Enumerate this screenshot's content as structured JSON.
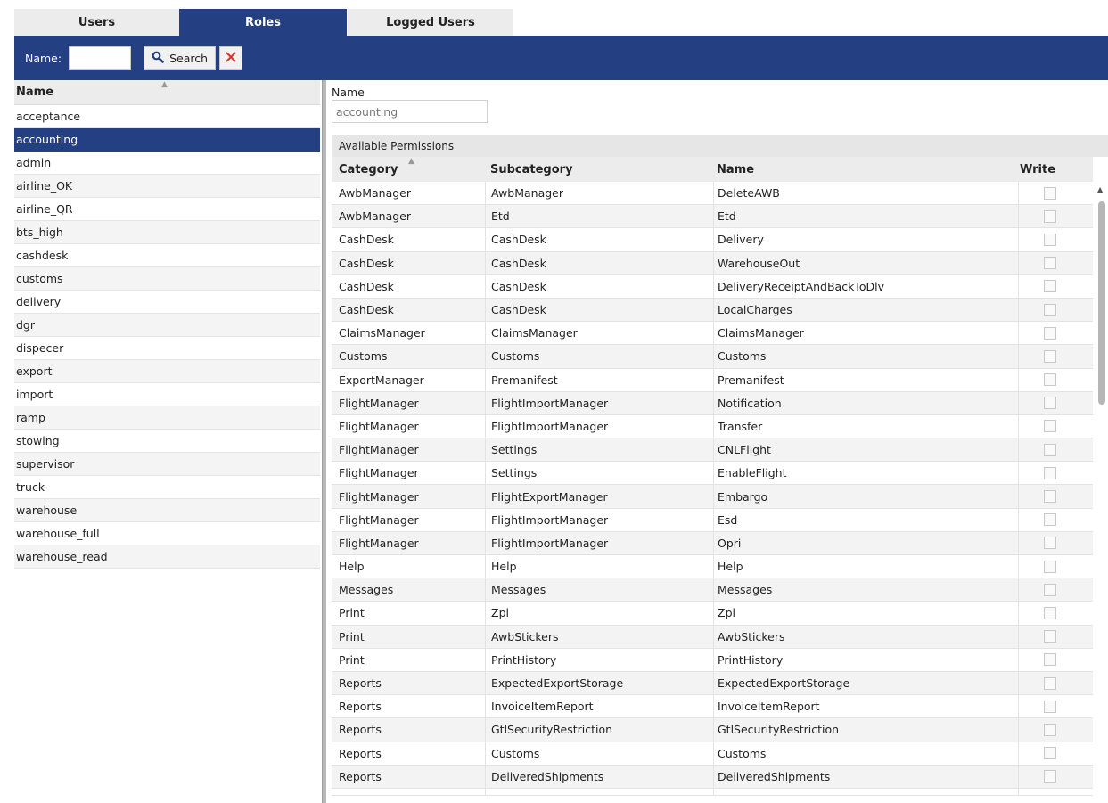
{
  "tabs": [
    {
      "label": "Users",
      "active": false
    },
    {
      "label": "Roles",
      "active": true
    },
    {
      "label": "Logged Users",
      "active": false
    }
  ],
  "toolbar": {
    "name_label": "Name:",
    "name_value": "",
    "search_label": "Search",
    "search_icon": "magnifier-icon",
    "clear_icon": "close-icon"
  },
  "roles_list": {
    "header": "Name",
    "sort": "ascending",
    "selected": "accounting",
    "items": [
      "acceptance",
      "accounting",
      "admin",
      "airline_OK",
      "airline_QR",
      "bts_high",
      "cashdesk",
      "customs",
      "delivery",
      "dgr",
      "dispecer",
      "export",
      "import",
      "ramp",
      "stowing",
      "supervisor",
      "truck",
      "warehouse",
      "warehouse_full",
      "warehouse_read"
    ]
  },
  "detail": {
    "name_label": "Name",
    "name_value": "accounting",
    "permissions_title": "Available Permissions",
    "columns": [
      "Category",
      "Subcategory",
      "Name",
      "Write"
    ],
    "sort_column": "Category",
    "rows": [
      {
        "category": "AwbManager",
        "subcategory": "AwbManager",
        "name": "DeleteAWB",
        "write": false
      },
      {
        "category": "AwbManager",
        "subcategory": "Etd",
        "name": "Etd",
        "write": false
      },
      {
        "category": "CashDesk",
        "subcategory": "CashDesk",
        "name": "Delivery",
        "write": false
      },
      {
        "category": "CashDesk",
        "subcategory": "CashDesk",
        "name": "WarehouseOut",
        "write": false
      },
      {
        "category": "CashDesk",
        "subcategory": "CashDesk",
        "name": "DeliveryReceiptAndBackToDlv",
        "write": false
      },
      {
        "category": "CashDesk",
        "subcategory": "CashDesk",
        "name": "LocalCharges",
        "write": false
      },
      {
        "category": "ClaimsManager",
        "subcategory": "ClaimsManager",
        "name": "ClaimsManager",
        "write": false
      },
      {
        "category": "Customs",
        "subcategory": "Customs",
        "name": "Customs",
        "write": false
      },
      {
        "category": "ExportManager",
        "subcategory": "Premanifest",
        "name": "Premanifest",
        "write": false
      },
      {
        "category": "FlightManager",
        "subcategory": "FlightImportManager",
        "name": "Notification",
        "write": false
      },
      {
        "category": "FlightManager",
        "subcategory": "FlightImportManager",
        "name": "Transfer",
        "write": false
      },
      {
        "category": "FlightManager",
        "subcategory": "Settings",
        "name": "CNLFlight",
        "write": false
      },
      {
        "category": "FlightManager",
        "subcategory": "Settings",
        "name": "EnableFlight",
        "write": false
      },
      {
        "category": "FlightManager",
        "subcategory": "FlightExportManager",
        "name": "Embargo",
        "write": false
      },
      {
        "category": "FlightManager",
        "subcategory": "FlightImportManager",
        "name": "Esd",
        "write": false
      },
      {
        "category": "FlightManager",
        "subcategory": "FlightImportManager",
        "name": "Opri",
        "write": false
      },
      {
        "category": "Help",
        "subcategory": "Help",
        "name": "Help",
        "write": false
      },
      {
        "category": "Messages",
        "subcategory": "Messages",
        "name": "Messages",
        "write": false
      },
      {
        "category": "Print",
        "subcategory": "Zpl",
        "name": "Zpl",
        "write": false
      },
      {
        "category": "Print",
        "subcategory": "AwbStickers",
        "name": "AwbStickers",
        "write": false
      },
      {
        "category": "Print",
        "subcategory": "PrintHistory",
        "name": "PrintHistory",
        "write": false
      },
      {
        "category": "Reports",
        "subcategory": "ExpectedExportStorage",
        "name": "ExpectedExportStorage",
        "write": false
      },
      {
        "category": "Reports",
        "subcategory": "InvoiceItemReport",
        "name": "InvoiceItemReport",
        "write": false
      },
      {
        "category": "Reports",
        "subcategory": "GtlSecurityRestriction",
        "name": "GtlSecurityRestriction",
        "write": false
      },
      {
        "category": "Reports",
        "subcategory": "Customs",
        "name": "Customs",
        "write": false
      },
      {
        "category": "Reports",
        "subcategory": "DeliveredShipments",
        "name": "DeliveredShipments",
        "write": false
      }
    ]
  },
  "colors": {
    "accent": "#243f82",
    "tab_inactive": "#ececec",
    "clear_red": "#d9342b"
  }
}
